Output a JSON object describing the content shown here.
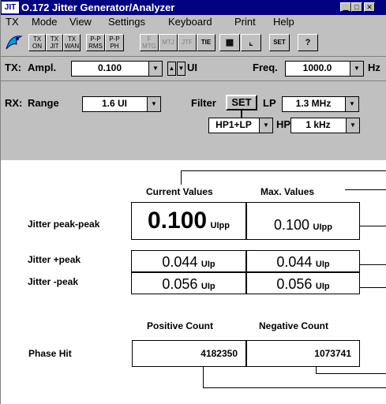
{
  "window": {
    "title": "O.172 Jitter Generator/Analyzer",
    "icon_text": "JIT",
    "controls": [
      "minimize-icon",
      "maximize-icon",
      "close-icon"
    ]
  },
  "menu": {
    "items": [
      "TX",
      "Mode",
      "View",
      "Settings",
      "Keyboard",
      "Print",
      "Help"
    ]
  },
  "toolbar": {
    "buttons": [
      {
        "name": "tx-on-button",
        "label": "TX ON"
      },
      {
        "name": "tx-jit-button",
        "label": "TX JIT"
      },
      {
        "name": "tx-wan-button",
        "label": "TX WAN"
      },
      {
        "name": "pp-rms-button",
        "label": "P-P RMS"
      },
      {
        "name": "pp-ph-button",
        "label": "P-P PH"
      },
      {
        "name": "f-mtg-button",
        "label": "F MTG"
      },
      {
        "name": "mtj-button",
        "label": "MTJ"
      },
      {
        "name": "jtf-button",
        "label": "JTF"
      },
      {
        "name": "tie-button",
        "label": "TIE"
      },
      {
        "name": "table-button",
        "label": "▦"
      },
      {
        "name": "graph-button",
        "label": "⌊"
      },
      {
        "name": "set-button",
        "label": "SET"
      },
      {
        "name": "help-button",
        "label": "?"
      }
    ]
  },
  "tx": {
    "label": "TX:",
    "ampl_label": "Ampl.",
    "ampl_value": "0.100",
    "ampl_unit": "UI",
    "freq_label": "Freq.",
    "freq_value": "1000.0",
    "freq_unit": "Hz"
  },
  "rx": {
    "label": "RX:",
    "range_label": "Range",
    "range_value": "1.6 UI",
    "filter_label": "Filter",
    "set_label": "SET",
    "lp_label": "LP",
    "lp_value": "1.3 MHz",
    "filter_mode": "HP1+LP",
    "hp_label": "HP",
    "hp_value": "1 kHz"
  },
  "results": {
    "col_current": "Current Values",
    "col_max": "Max. Values",
    "rows": [
      {
        "label": "Jitter  peak-peak",
        "current": "0.100",
        "current_unit": "UIpp",
        "max": "0.100",
        "max_unit": "UIpp"
      },
      {
        "label": "Jitter  +peak",
        "current": "0.044",
        "current_unit": "UIp",
        "max": "0.044",
        "max_unit": "UIp"
      },
      {
        "label": "Jitter  -peak",
        "current": "0.056",
        "current_unit": "UIp",
        "max": "0.056",
        "max_unit": "UIp"
      }
    ],
    "count_pos_header": "Positive Count",
    "count_neg_header": "Negative Count",
    "phase_hit_label": "Phase Hit",
    "positive_count": "4182350",
    "negative_count": "1073741"
  }
}
